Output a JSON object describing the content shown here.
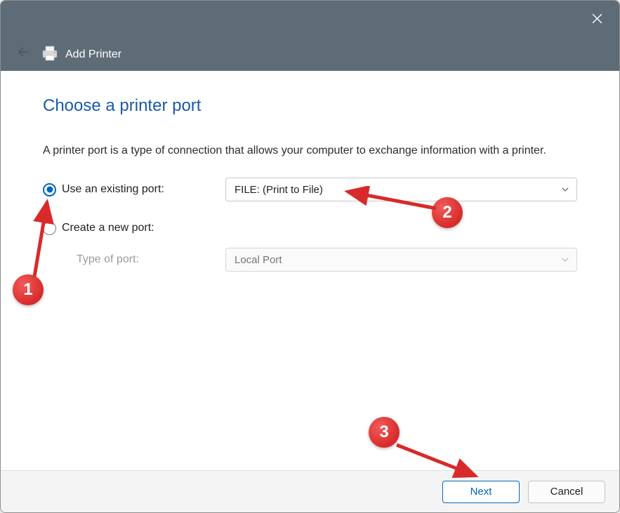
{
  "window": {
    "title": "Add Printer"
  },
  "page": {
    "heading": "Choose a printer port",
    "description": "A printer port is a type of connection that allows your computer to exchange information with a printer."
  },
  "options": {
    "existing": {
      "label": "Use an existing port:",
      "selected": true,
      "value": "FILE: (Print to File)"
    },
    "create": {
      "label": "Create a new port:",
      "selected": false,
      "type_label": "Type of port:",
      "type_value": "Local Port"
    }
  },
  "buttons": {
    "next": "Next",
    "cancel": "Cancel"
  },
  "annotations": {
    "b1": "1",
    "b2": "2",
    "b3": "3"
  },
  "colors": {
    "accent": "#0067c0",
    "heading": "#1a5aa8",
    "titlebar": "#5e6c77",
    "annotation": "#d82a2a"
  }
}
